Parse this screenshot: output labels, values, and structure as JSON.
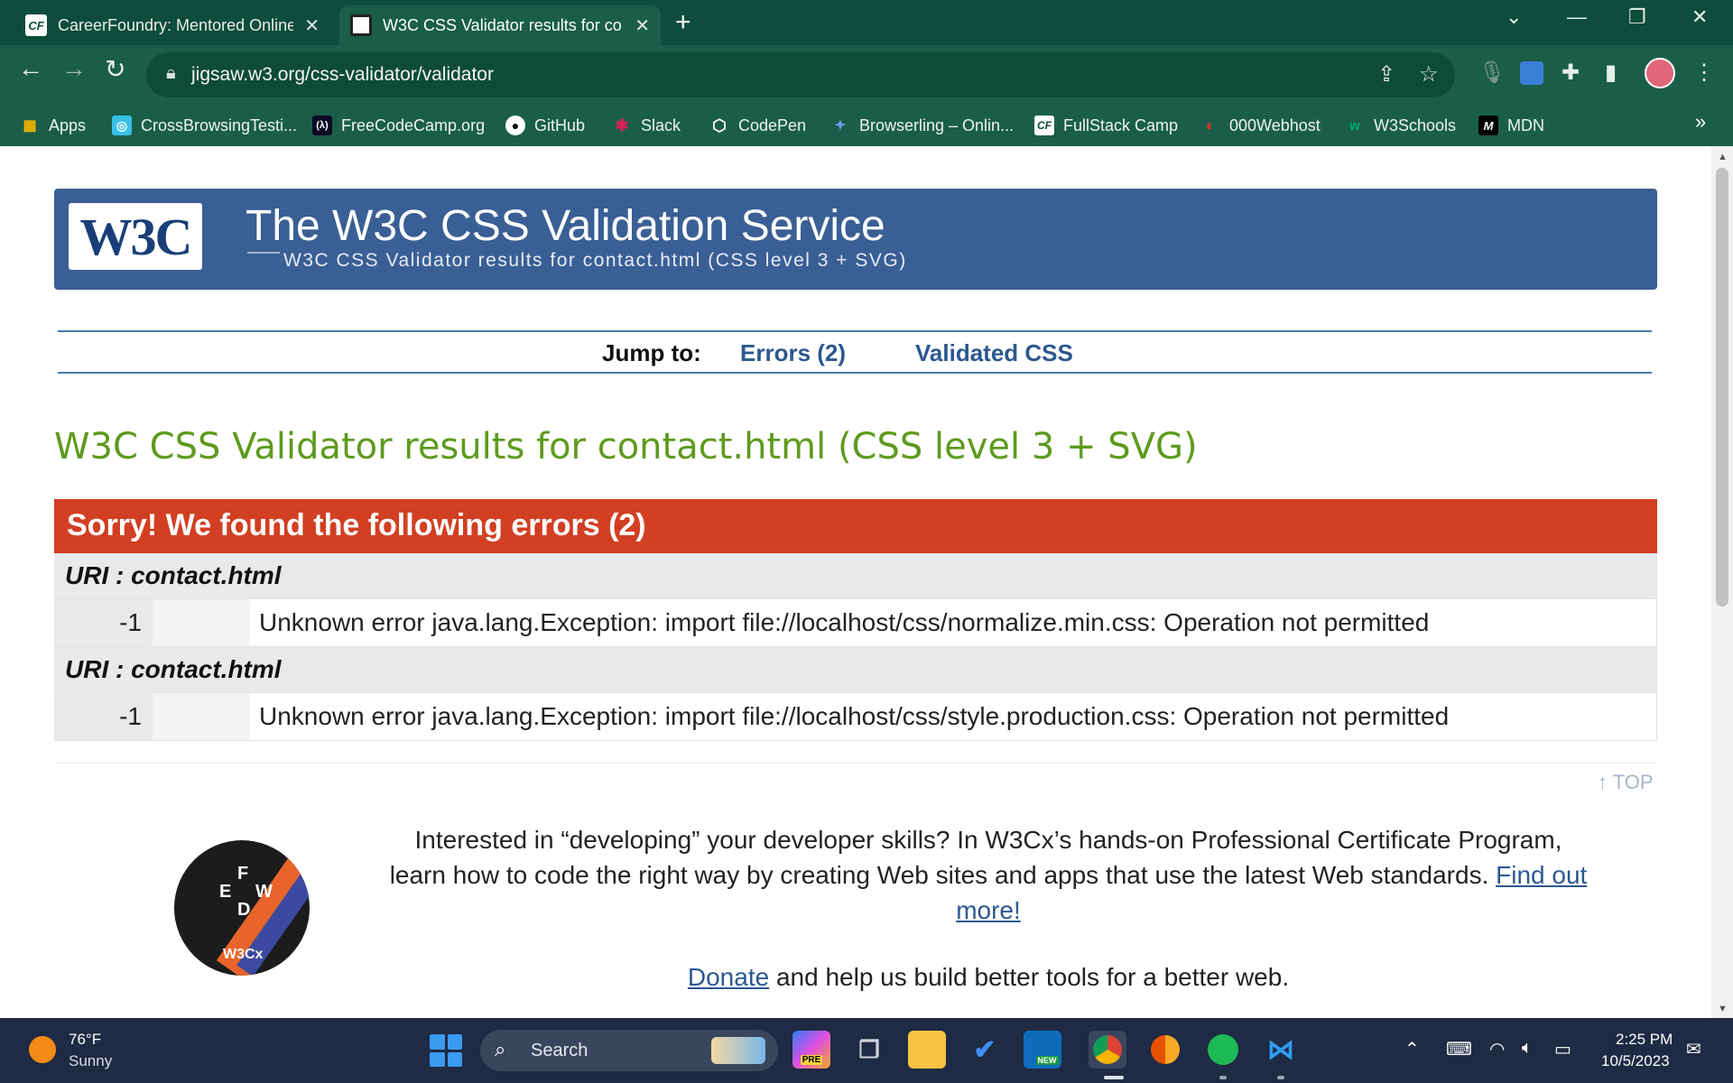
{
  "browser": {
    "tabs": [
      {
        "title": "CareerFoundry: Mentored Online",
        "favicon": "CF"
      },
      {
        "title": "W3C CSS Validator results for co",
        "favicon": "W3"
      }
    ],
    "new_tab_icon": "plus-icon",
    "url": "jigsaw.w3.org/css-validator/validator",
    "bookmarks": [
      {
        "label": "Apps",
        "icon": "apps-grid-icon",
        "color": "#f4b400"
      },
      {
        "label": "CrossBrowsingTesti...",
        "icon": "crossbrowser-icon",
        "color": "#39c0e8"
      },
      {
        "label": "FreeCodeCamp.org",
        "icon": "freecodecamp-icon",
        "color": "#0a0a23"
      },
      {
        "label": "GitHub",
        "icon": "github-icon",
        "color": "#ffffff"
      },
      {
        "label": "Slack",
        "icon": "slack-icon",
        "color": "#e01e5a"
      },
      {
        "label": "CodePen",
        "icon": "codepen-icon",
        "color": "#ffffff"
      },
      {
        "label": "Browserling – Onlin...",
        "icon": "browserling-icon",
        "color": "#4a7fd4"
      },
      {
        "label": "FullStack Camp",
        "icon": "careerfoundry-icon",
        "color": "#ffffff"
      },
      {
        "label": "000Webhost",
        "icon": "webhost-icon",
        "color": "#d9342b"
      },
      {
        "label": "W3Schools",
        "icon": "w3schools-icon",
        "color": "#04aa6d"
      },
      {
        "label": "MDN",
        "icon": "mdn-icon",
        "color": "#000000"
      }
    ],
    "more_bookmarks": "»"
  },
  "page": {
    "banner": {
      "logo": "W3C",
      "title": "The W3C CSS Validation Service",
      "subtitle": "W3C CSS Validator results for contact.html (CSS level 3 + SVG)"
    },
    "jump": {
      "label": "Jump to:",
      "errors_link": "Errors (2)",
      "validated_link": "Validated CSS"
    },
    "heading": "W3C CSS Validator results for contact.html (CSS level 3 + SVG)",
    "errors_header": "Sorry! We found the following errors (2)",
    "errors": [
      {
        "uri": "URI : contact.html",
        "line": "-1",
        "message": "Unknown error java.lang.Exception: import file://localhost/css/normalize.min.css: Operation not permitted"
      },
      {
        "uri": "URI : contact.html",
        "line": "-1",
        "message": "Unknown error java.lang.Exception: import file://localhost/css/style.production.css: Operation not permitted"
      }
    ],
    "top_link": "↑ TOP",
    "badge": {
      "letters": [
        "F",
        "E",
        "W",
        "D"
      ],
      "brand": "W3Cx"
    },
    "promo": {
      "text": "Interested in “developing” your developer skills? In W3Cx’s hands-on Professional Certificate Program, learn how to code the right way by creating Web sites and apps that use the latest Web standards.",
      "link": "Find out more!"
    },
    "donate": {
      "link": "Donate",
      "text": "and help us build better tools for a better web."
    }
  },
  "taskbar": {
    "weather": {
      "temp": "76°F",
      "desc": "Sunny"
    },
    "search_placeholder": "Search",
    "clock": {
      "time": "2:25 PM",
      "date": "10/5/2023"
    },
    "pre_badge": "PRE",
    "new_badge": "NEW"
  },
  "colors": {
    "chrome_dark": "#0e4c3b",
    "chrome": "#1a5e4a",
    "banner": "#3a5f95",
    "heading_green": "#5e9a1e",
    "error_red": "#d23f22",
    "link_blue": "#2c5890"
  }
}
